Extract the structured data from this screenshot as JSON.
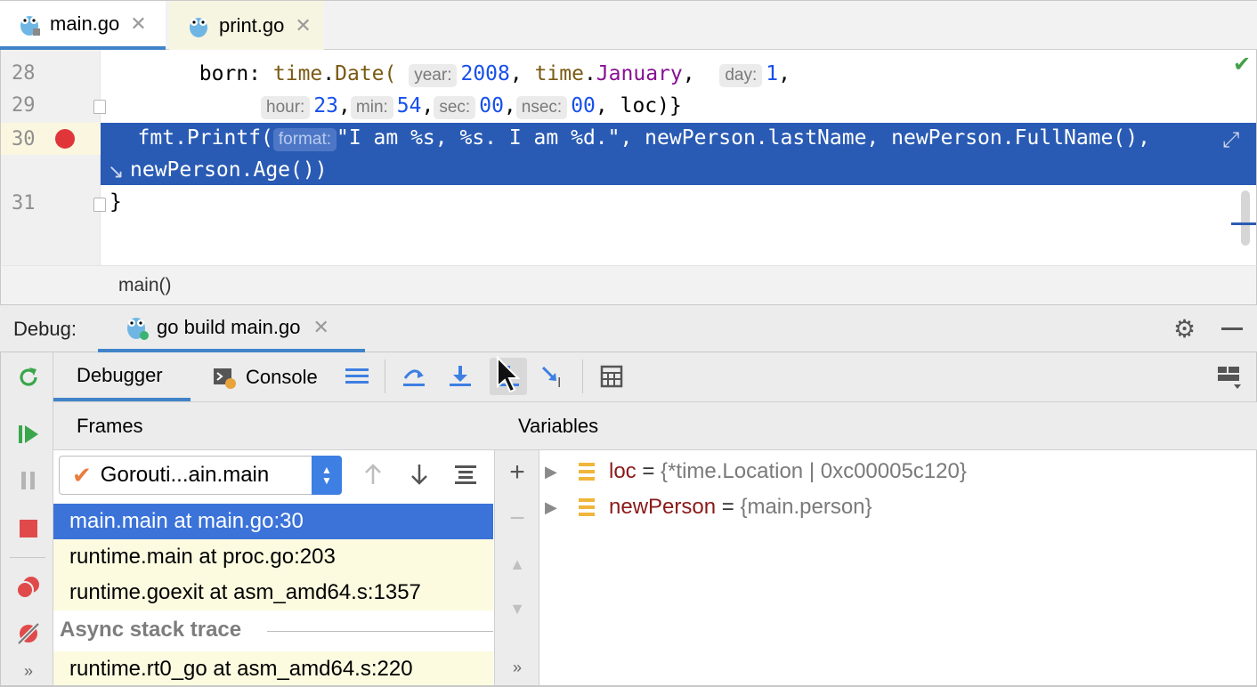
{
  "editor_tabs": [
    {
      "label": "main.go",
      "active": true
    },
    {
      "label": "print.go",
      "active": false
    }
  ],
  "editor": {
    "lines": {
      "l28": {
        "num": "28",
        "indent": "    born: ",
        "pkg1": "time",
        "dot1": ".",
        "fn1": "Date(",
        "hint_year": "year:",
        "year": "2008",
        "sep1": ", ",
        "pkg2": "time",
        "dot2": ".",
        "month": "January",
        "sep2": ",  ",
        "hint_day": "day:",
        "day": "1",
        "end": ","
      },
      "l29": {
        "num": "29",
        "hint_hour": "hour:",
        "hour": "23",
        "hint_min": "min:",
        "min": "54",
        "hint_sec": "sec:",
        "sec": "00",
        "hint_nsec": "nsec:",
        "nsec": "00",
        "tail": ", loc)}"
      },
      "l30": {
        "num": "30",
        "call": "fmt.Printf(",
        "hint_format": "format:",
        "args": "\"I am %s, %s. I am %d.\", newPerson.lastName, newPerson.FullName(),",
        "wrap": "newPerson.Age())"
      },
      "l31": {
        "num": "31",
        "text": "}"
      }
    },
    "status": "check-icon"
  },
  "breadcrumb": "main()",
  "debug": {
    "label": "Debug:",
    "run_tab": "go build main.go",
    "subtabs": {
      "debugger": "Debugger",
      "console": "Console"
    }
  },
  "frames": {
    "header": "Frames",
    "goroutine": "Gorouti...ain.main",
    "rows": [
      "main.main at main.go:30",
      "runtime.main at proc.go:203",
      "runtime.goexit at asm_amd64.s:1357"
    ],
    "async_label": "Async stack trace",
    "async_rows": [
      "runtime.rt0_go at asm_amd64.s:220"
    ]
  },
  "variables": {
    "header": "Variables",
    "items": [
      {
        "name": "loc",
        "eq": " = ",
        "value": "{*time.Location | 0xc00005c120}"
      },
      {
        "name": "newPerson",
        "eq": " = ",
        "value": "{main.person}"
      }
    ]
  },
  "colors": {
    "accent": "#4083c9",
    "selection": "#2a5bb4",
    "breakpoint": "#e0363a",
    "frame_selected": "#3b73d9"
  }
}
